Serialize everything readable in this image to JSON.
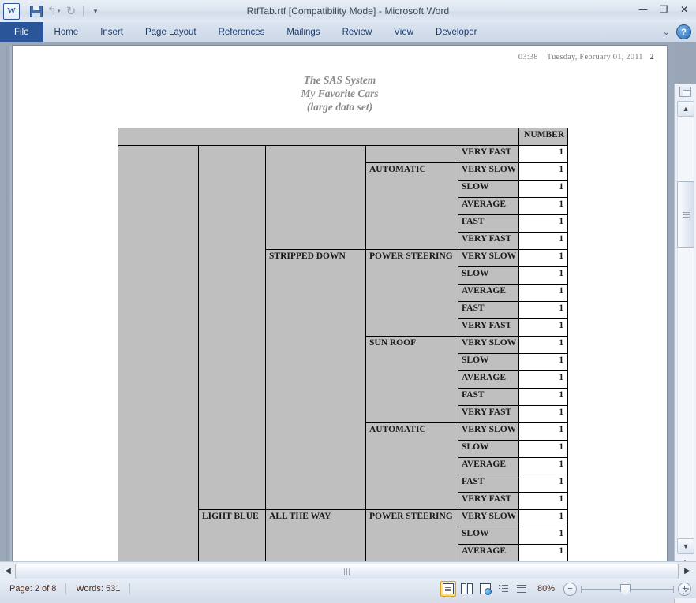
{
  "window": {
    "title": "RtfTab.rtf [Compatibility Mode]  -  Microsoft Word",
    "app_logo": "word-logo",
    "minimize": "—",
    "restore": "❐",
    "close": "✕"
  },
  "quick_access": {
    "save": "save-icon",
    "undo": "↰",
    "redo": "↻",
    "customize": "⌄"
  },
  "ribbon": {
    "tabs": [
      {
        "label": "File",
        "active": true
      },
      {
        "label": "Home",
        "active": false
      },
      {
        "label": "Insert",
        "active": false
      },
      {
        "label": "Page Layout",
        "active": false
      },
      {
        "label": "References",
        "active": false
      },
      {
        "label": "Mailings",
        "active": false
      },
      {
        "label": "Review",
        "active": false
      },
      {
        "label": "View",
        "active": false
      },
      {
        "label": "Developer",
        "active": false
      }
    ],
    "collapse_icon": "chevron-up-icon",
    "help_label": "?"
  },
  "document": {
    "header": {
      "time": "03:38",
      "date": "Tuesday, February 01, 2011",
      "page_number": "2"
    },
    "titles": [
      "The SAS System",
      "My Favorite Cars",
      "(large data set)"
    ],
    "table": {
      "column_header": "NUMBER",
      "columns": [
        "",
        "",
        "",
        "",
        "",
        "NUMBER"
      ],
      "rows": [
        {
          "c1": "",
          "c2": "",
          "c3": "",
          "c4": "",
          "c5": "VERY FAST",
          "num": "1"
        },
        {
          "c1": "",
          "c2": "",
          "c3": "",
          "c4": "AUTOMATIC",
          "c5": "VERY SLOW",
          "num": "1"
        },
        {
          "c1": "",
          "c2": "",
          "c3": "",
          "c4": "",
          "c5": "SLOW",
          "num": "1"
        },
        {
          "c1": "",
          "c2": "",
          "c3": "",
          "c4": "",
          "c5": "AVERAGE",
          "num": "1"
        },
        {
          "c1": "",
          "c2": "",
          "c3": "",
          "c4": "",
          "c5": "FAST",
          "num": "1"
        },
        {
          "c1": "",
          "c2": "",
          "c3": "",
          "c4": "",
          "c5": "VERY FAST",
          "num": "1"
        },
        {
          "c1": "",
          "c2": "",
          "c3": "STRIPPED DOWN",
          "c4": "POWER STEERING",
          "c5": "VERY SLOW",
          "num": "1"
        },
        {
          "c1": "",
          "c2": "",
          "c3": "",
          "c4": "",
          "c5": "SLOW",
          "num": "1"
        },
        {
          "c1": "",
          "c2": "",
          "c3": "",
          "c4": "",
          "c5": "AVERAGE",
          "num": "1"
        },
        {
          "c1": "",
          "c2": "",
          "c3": "",
          "c4": "",
          "c5": "FAST",
          "num": "1"
        },
        {
          "c1": "",
          "c2": "",
          "c3": "",
          "c4": "",
          "c5": "VERY FAST",
          "num": "1"
        },
        {
          "c1": "",
          "c2": "",
          "c3": "",
          "c4": "SUN ROOF",
          "c5": "VERY SLOW",
          "num": "1"
        },
        {
          "c1": "",
          "c2": "",
          "c3": "",
          "c4": "",
          "c5": "SLOW",
          "num": "1"
        },
        {
          "c1": "",
          "c2": "",
          "c3": "",
          "c4": "",
          "c5": "AVERAGE",
          "num": "1"
        },
        {
          "c1": "",
          "c2": "",
          "c3": "",
          "c4": "",
          "c5": "FAST",
          "num": "1"
        },
        {
          "c1": "",
          "c2": "",
          "c3": "",
          "c4": "",
          "c5": "VERY FAST",
          "num": "1"
        },
        {
          "c1": "",
          "c2": "",
          "c3": "",
          "c4": "AUTOMATIC",
          "c5": "VERY SLOW",
          "num": "1"
        },
        {
          "c1": "",
          "c2": "",
          "c3": "",
          "c4": "",
          "c5": "SLOW",
          "num": "1"
        },
        {
          "c1": "",
          "c2": "",
          "c3": "",
          "c4": "",
          "c5": "AVERAGE",
          "num": "1"
        },
        {
          "c1": "",
          "c2": "",
          "c3": "",
          "c4": "",
          "c5": "FAST",
          "num": "1"
        },
        {
          "c1": "",
          "c2": "",
          "c3": "",
          "c4": "",
          "c5": "VERY FAST",
          "num": "1"
        },
        {
          "c1": "",
          "c2": "LIGHT BLUE",
          "c3": "ALL THE WAY",
          "c4": "POWER STEERING",
          "c5": "VERY SLOW",
          "num": "1"
        },
        {
          "c1": "",
          "c2": "",
          "c3": "",
          "c4": "",
          "c5": "SLOW",
          "num": "1"
        },
        {
          "c1": "",
          "c2": "",
          "c3": "",
          "c4": "",
          "c5": "AVERAGE",
          "num": "1"
        }
      ]
    }
  },
  "scrollbars": {
    "v_split": "split-window-icon",
    "v_up": "▲",
    "v_down": "▼",
    "prev_page": "⯅",
    "browse_object": "browse-object-icon",
    "next_page": "⯆",
    "h_left": "◀",
    "h_right": "▶"
  },
  "status_bar": {
    "page": "Page: 2 of 8",
    "words": "Words: 531",
    "views": [
      {
        "name": "print-layout",
        "active": true
      },
      {
        "name": "full-screen-reading",
        "active": false
      },
      {
        "name": "web-layout",
        "active": false
      },
      {
        "name": "outline",
        "active": false
      },
      {
        "name": "draft",
        "active": false
      }
    ],
    "zoom_level": "80%",
    "zoom_out": "−",
    "zoom_in": "+"
  },
  "colors": {
    "accent": "#2a5699",
    "table_cell": "#bfbfbf",
    "title_text": "#8a8a8a"
  }
}
